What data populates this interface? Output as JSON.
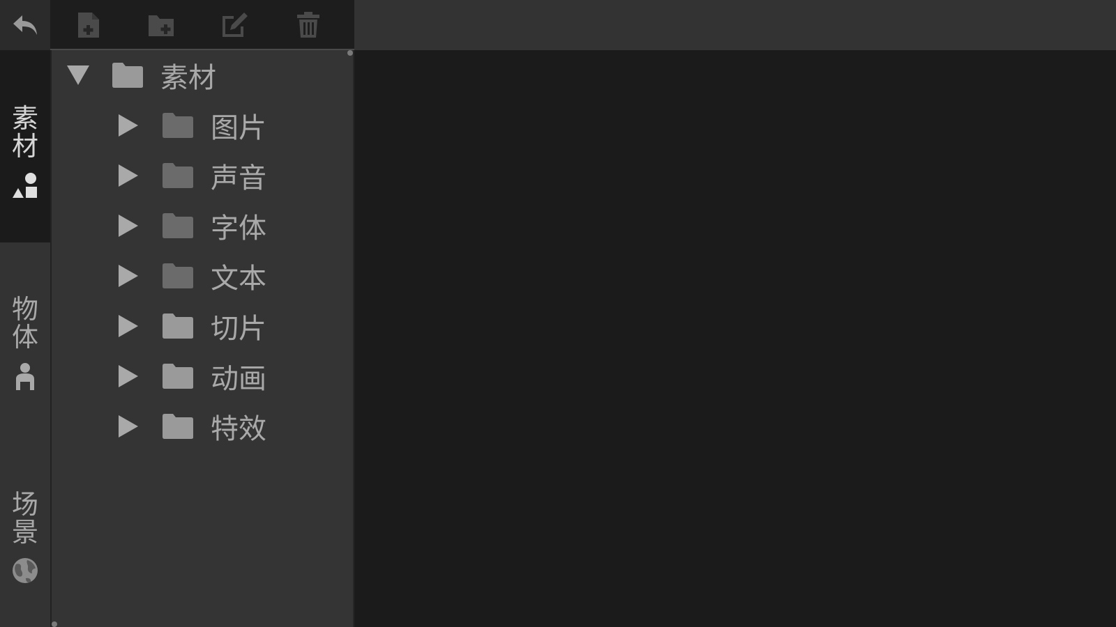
{
  "toolbar": {
    "back_icon": "back-arrow-icon",
    "buttons": [
      {
        "icon": "new-file-icon"
      },
      {
        "icon": "new-folder-icon"
      },
      {
        "icon": "edit-icon"
      },
      {
        "icon": "trash-icon"
      }
    ]
  },
  "sidebar": {
    "tabs": [
      {
        "label": "素材",
        "icon": "shapes-icon",
        "active": true
      },
      {
        "label": "物体",
        "icon": "person-icon",
        "active": false
      },
      {
        "label": "场景",
        "icon": "globe-icon",
        "active": false
      }
    ]
  },
  "tree": {
    "root": {
      "label": "素材",
      "expanded": true
    },
    "children": [
      {
        "label": "图片",
        "expanded": false
      },
      {
        "label": "声音",
        "expanded": false
      },
      {
        "label": "字体",
        "expanded": false
      },
      {
        "label": "文本",
        "expanded": false
      },
      {
        "label": "切片",
        "expanded": false
      },
      {
        "label": "动画",
        "expanded": false
      },
      {
        "label": "特效",
        "expanded": false
      }
    ]
  },
  "colors": {
    "background": "#1b1b1b",
    "panel": "#343434",
    "toolbar": "#1d1d1d",
    "text": "#a9a9a9",
    "folder_light": "#9a9a9a",
    "folder_dark": "#6b6b6b"
  }
}
